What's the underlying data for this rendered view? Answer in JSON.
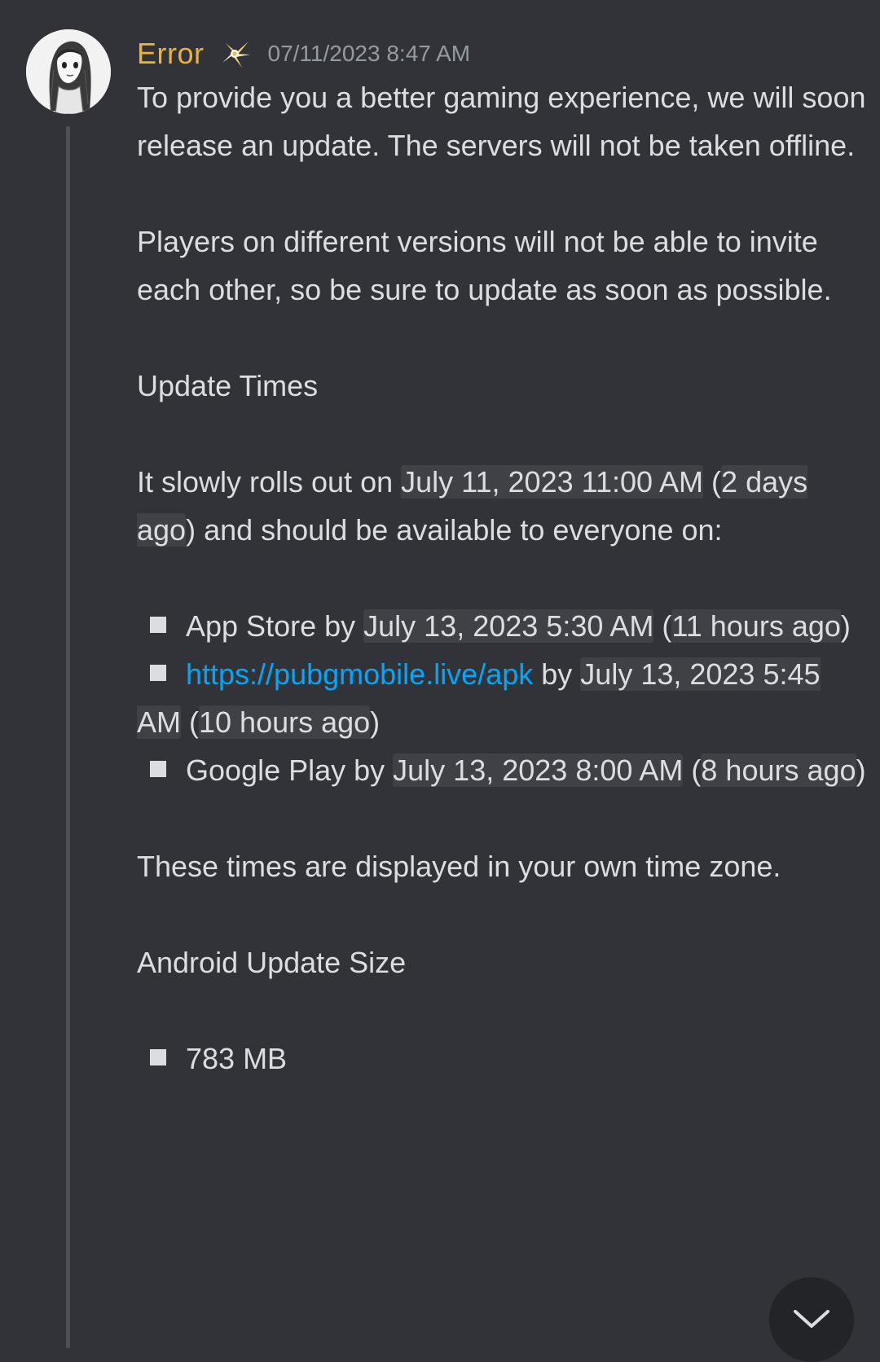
{
  "message": {
    "author": "Error",
    "timestamp": "07/11/2023 8:47 AM",
    "colors": {
      "author": "#f0b232",
      "link": "#00a8fc",
      "background": "#313338",
      "text": "#dbdee1",
      "timestamp_pill": "#3f4147"
    },
    "badge_icon": "sparkle-badge-icon",
    "avatar_icon": "anime-girl-avatar",
    "p1": "To provide you a better gaming experience, we will soon release an update. The servers will not be taken offline.",
    "p2": "Players on different versions will not be able to invite each other, so be sure to update as soon as possible.",
    "update_times_heading": "Update Times",
    "rollout": {
      "prefix": "It slowly rolls out on ",
      "date": "July 11, 2023 11:00 AM",
      "open_paren": " (",
      "relative": "2 days ago",
      "suffix": ") and should be available to everyone on:"
    },
    "stores": [
      {
        "label": "App Store",
        "by": " by ",
        "date": "July 13, 2023 5:30 AM",
        "open_paren": " (",
        "relative": "11 hours ago",
        "close_paren": ")"
      },
      {
        "label": "https://pubgmobile.live/apk",
        "by": " by ",
        "date": "July 13, 2023 5:45 AM",
        "open_paren": " (",
        "relative": "10 hours ago",
        "close_paren": ")"
      },
      {
        "label": "Google Play",
        "by": " by ",
        "date": "July 13, 2023 8:00 AM",
        "open_paren": " (",
        "relative": "8 hours ago",
        "close_paren": ")"
      }
    ],
    "timezone_note": "These times are displayed in your own time zone.",
    "android_heading": "Android Update Size",
    "android_sizes": [
      "783 MB"
    ]
  },
  "scroll_button_icon": "chevron-down-icon"
}
